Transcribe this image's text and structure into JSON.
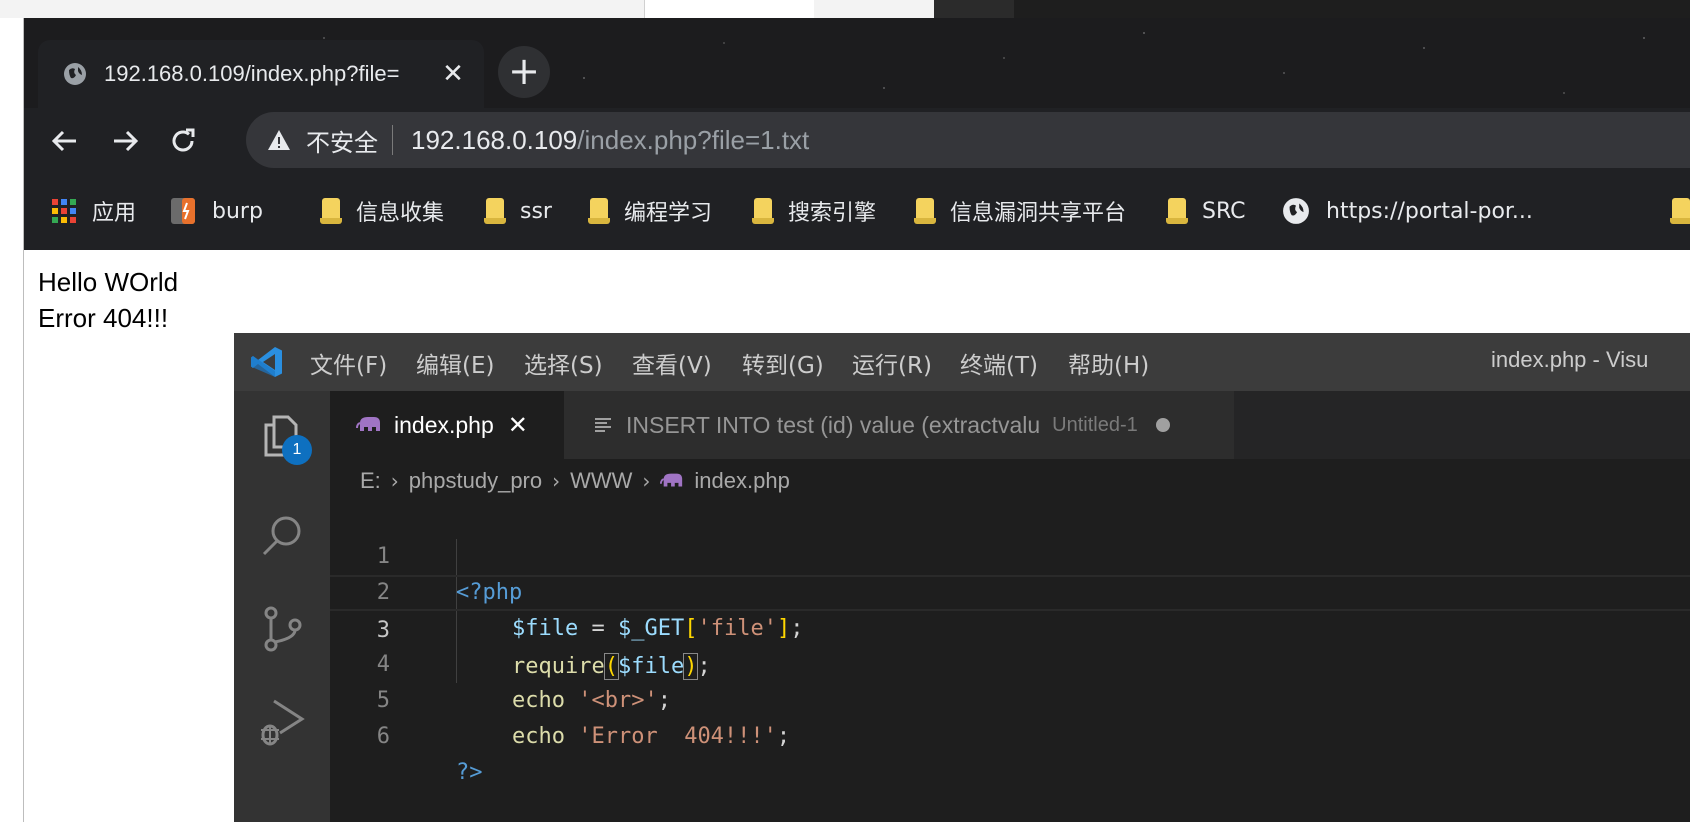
{
  "browser": {
    "tab_title": "192.168.0.109/index.php?file=",
    "tab_close": "✕",
    "new_tab": "+",
    "address": {
      "security_label": "不安全",
      "host": "192.168.0.109",
      "path": "/index.php?file=1.txt"
    },
    "bookmarks": [
      {
        "label": "应用",
        "icon": "apps-grid-icon"
      },
      {
        "label": "burp",
        "icon": "burp-icon"
      },
      {
        "label": "信息收集",
        "icon": "folder-icon"
      },
      {
        "label": "ssr",
        "icon": "folder-icon"
      },
      {
        "label": "编程学习",
        "icon": "folder-icon"
      },
      {
        "label": "搜索引擎",
        "icon": "folder-icon"
      },
      {
        "label": "信息漏洞共享平台",
        "icon": "folder-icon"
      },
      {
        "label": "SRC",
        "icon": "folder-icon"
      },
      {
        "label": "https://portal-por...",
        "icon": "globe-icon"
      }
    ],
    "page": {
      "line1": "Hello WOrld",
      "line2": "Error 404!!!"
    }
  },
  "vscode": {
    "menu": [
      "文件(F)",
      "编辑(E)",
      "选择(S)",
      "查看(V)",
      "转到(G)",
      "运行(R)",
      "终端(T)",
      "帮助(H)"
    ],
    "window_title": "index.php - Visu",
    "explorer_badge": "1",
    "tabs": [
      {
        "label": "index.php",
        "close": "✕"
      },
      {
        "label": "INSERT INTO test (id) value (extractvalu",
        "description": "Untitled-1"
      }
    ],
    "breadcrumb": [
      "E:",
      "phpstudy_pro",
      "WWW",
      "index.php"
    ],
    "line_numbers": [
      "1",
      "2",
      "3",
      "4",
      "5",
      "6"
    ],
    "code": {
      "l1_open": "<?php",
      "l2_var": "$file",
      "l2_eq": " = ",
      "l2_get": "$_GET",
      "l2_lb": "[",
      "l2_key": "'file'",
      "l2_rb": "]",
      "l2_semi": ";",
      "l3_fn": "require",
      "l3_lp": "(",
      "l3_var": "$file",
      "l3_rp": ")",
      "l3_semi": ";",
      "l4_kw": "echo",
      "l4_str": "'<br>'",
      "l4_semi": ";",
      "l5_kw": "echo",
      "l5_str": "'Error  404!!!'",
      "l5_semi": ";",
      "l6_close": "?>"
    }
  }
}
